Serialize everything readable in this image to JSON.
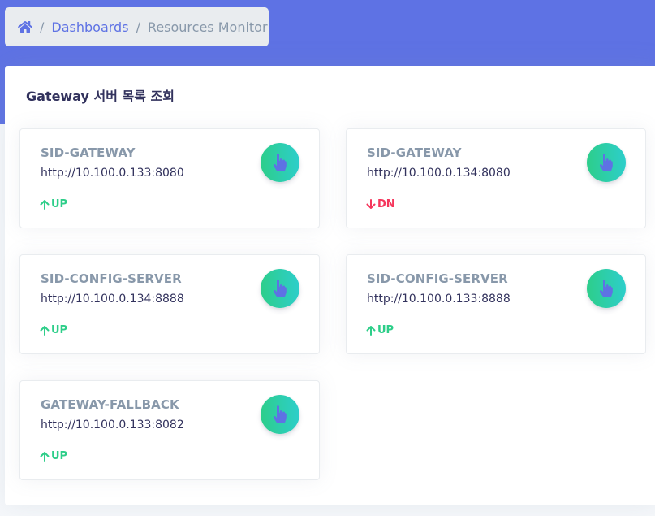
{
  "breadcrumb": {
    "home_icon": "home-icon",
    "separator": "/",
    "items": [
      {
        "label": "Dashboards"
      },
      {
        "label": "Resources Monitor"
      }
    ]
  },
  "panel": {
    "title": "Gateway 서버 목록 조회"
  },
  "colors": {
    "header": "#5e72e4",
    "up": "#2dce89",
    "down": "#f5365c",
    "badge_gradient": [
      "#2dce89",
      "#2dcecc"
    ]
  },
  "cards": [
    {
      "name": "SID-GATEWAY",
      "url": "http://10.100.0.133:8080",
      "status": "UP",
      "status_icon": "arrow-up-icon",
      "badge_icon": "hand-pointer-icon"
    },
    {
      "name": "SID-GATEWAY",
      "url": "http://10.100.0.134:8080",
      "status": "DN",
      "status_icon": "arrow-down-icon",
      "badge_icon": "hand-pointer-icon"
    },
    {
      "name": "SID-CONFIG-SERVER",
      "url": "http://10.100.0.134:8888",
      "status": "UP",
      "status_icon": "arrow-up-icon",
      "badge_icon": "hand-pointer-icon"
    },
    {
      "name": "SID-CONFIG-SERVER",
      "url": "http://10.100.0.133:8888",
      "status": "UP",
      "status_icon": "arrow-up-icon",
      "badge_icon": "hand-pointer-icon"
    },
    {
      "name": "GATEWAY-FALLBACK",
      "url": "http://10.100.0.133:8082",
      "status": "UP",
      "status_icon": "arrow-up-icon",
      "badge_icon": "hand-pointer-icon"
    }
  ]
}
